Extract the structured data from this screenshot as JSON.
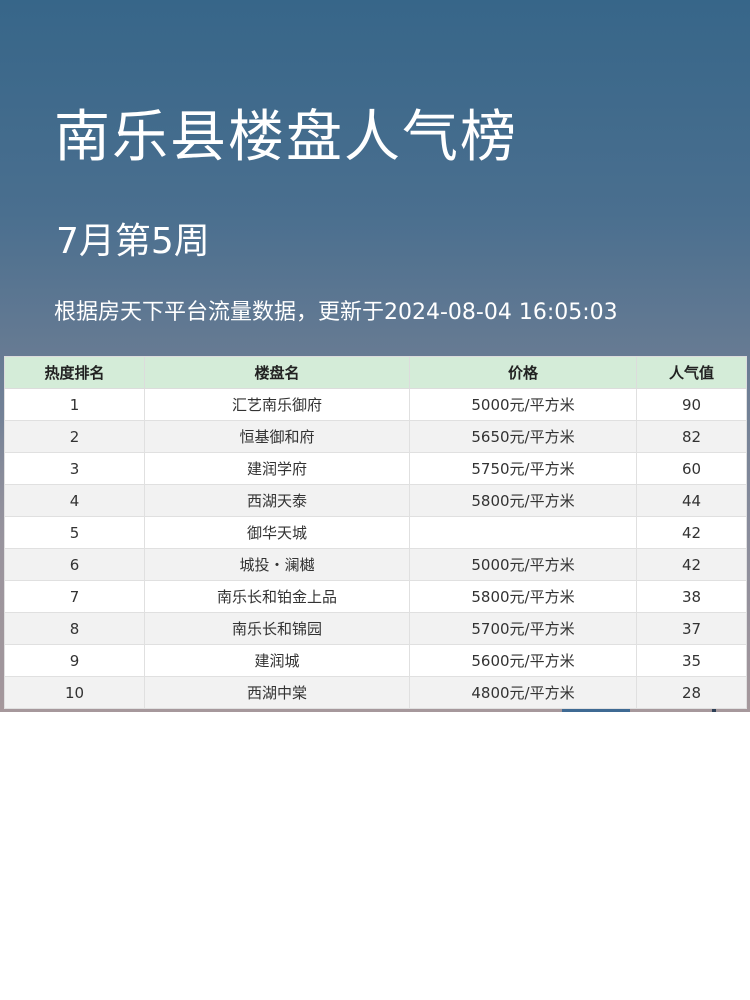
{
  "header": {
    "title": "南乐县楼盘人气榜",
    "subtitle": "7月第5周",
    "update_text": "根据房天下平台流量数据，更新于2024-08-04  16:05:03"
  },
  "table": {
    "columns": [
      "热度排名",
      "楼盘名",
      "价格",
      "人气值"
    ],
    "rows": [
      {
        "rank": "1",
        "name": "汇艺南乐御府",
        "price": "5000元/平方米",
        "popularity": "90"
      },
      {
        "rank": "2",
        "name": "恒基御和府",
        "price": "5650元/平方米",
        "popularity": "82"
      },
      {
        "rank": "3",
        "name": "建润学府",
        "price": "5750元/平方米",
        "popularity": "60"
      },
      {
        "rank": "4",
        "name": "西湖天泰",
        "price": "5800元/平方米",
        "popularity": "44"
      },
      {
        "rank": "5",
        "name": "御华天城",
        "price": "",
        "popularity": "42"
      },
      {
        "rank": "6",
        "name": "城投・澜樾",
        "price": "5000元/平方米",
        "popularity": "42"
      },
      {
        "rank": "7",
        "name": "南乐长和铂金上品",
        "price": "5800元/平方米",
        "popularity": "38"
      },
      {
        "rank": "8",
        "name": "南乐长和锦园",
        "price": "5700元/平方米",
        "popularity": "37"
      },
      {
        "rank": "9",
        "name": "建润城",
        "price": "5600元/平方米",
        "popularity": "35"
      },
      {
        "rank": "10",
        "name": "西湖中棠",
        "price": "4800元/平方米",
        "popularity": "28"
      }
    ]
  },
  "colors": {
    "header_row_bg": "#d4ecd8",
    "even_row_bg": "#f2f2f2",
    "hero_top": "#376689",
    "hero_bottom": "#a6989c"
  }
}
